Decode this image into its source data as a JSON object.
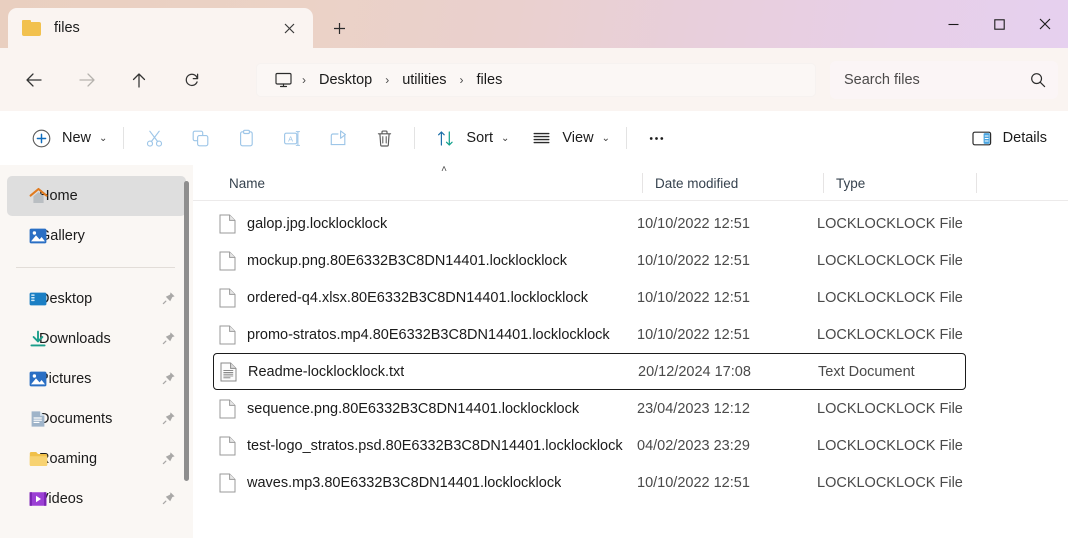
{
  "window": {
    "tab_title": "files",
    "tab_folder_icon": "folder-icon",
    "close_tab_icon": "close-icon",
    "new_tab_icon": "plus-icon",
    "minimize_icon": "minimize-icon",
    "maximize_icon": "maximize-icon",
    "close_icon": "close-icon",
    "titlebar_gradient_start": "#e9cfc0",
    "titlebar_gradient_end": "#e6d0ef"
  },
  "nav": {
    "back_icon": "arrow-left-icon",
    "forward_icon": "arrow-right-icon",
    "up_icon": "arrow-up-icon",
    "refresh_icon": "refresh-icon",
    "breadcrumb_root_icon": "desktop-monitor-icon",
    "breadcrumbs": [
      {
        "label": "Desktop"
      },
      {
        "label": "utilities"
      },
      {
        "label": "files"
      }
    ],
    "separator": "›"
  },
  "search": {
    "placeholder": "Search files",
    "icon": "search-icon"
  },
  "toolbar": {
    "new_label": "New",
    "new_icon": "plus-circle-icon",
    "cut_icon": "scissors-icon",
    "copy_icon": "copy-icon",
    "paste_icon": "paste-icon",
    "rename_icon": "rename-icon",
    "share_icon": "share-icon",
    "delete_icon": "trash-icon",
    "sort_label": "Sort",
    "sort_icon": "sort-arrows-icon",
    "view_label": "View",
    "view_icon": "view-lines-icon",
    "more_icon": "ellipsis-icon",
    "details_label": "Details",
    "details_icon": "details-pane-icon",
    "chevron": "⌄"
  },
  "sidebar": {
    "items": [
      {
        "label": "Home",
        "icon": "home-icon",
        "selected": true,
        "pinned": false
      },
      {
        "label": "Gallery",
        "icon": "gallery-icon",
        "selected": false,
        "pinned": false
      },
      {
        "label": "Desktop",
        "icon": "desktop-icon",
        "selected": false,
        "pinned": true
      },
      {
        "label": "Downloads",
        "icon": "download-icon",
        "selected": false,
        "pinned": true
      },
      {
        "label": "Pictures",
        "icon": "pictures-icon",
        "selected": false,
        "pinned": true
      },
      {
        "label": "Documents",
        "icon": "documents-icon",
        "selected": false,
        "pinned": true
      },
      {
        "label": "Roaming",
        "icon": "folder-icon",
        "selected": false,
        "pinned": true
      },
      {
        "label": "Videos",
        "icon": "videos-icon",
        "selected": false,
        "pinned": true
      }
    ],
    "scrollbar": "sidebar-scrollbar"
  },
  "file_list": {
    "columns": [
      {
        "label": "Name"
      },
      {
        "label": "Date modified"
      },
      {
        "label": "Type"
      }
    ],
    "sort_indicator": "˄",
    "rows": [
      {
        "name": "galop.jpg.locklocklock",
        "date": "10/10/2022 12:51",
        "type": "LOCKLOCKLOCK File",
        "icon": "generic-file-icon",
        "focused": false
      },
      {
        "name": "mockup.png.80E6332B3C8DN14401.locklocklock",
        "date": "10/10/2022 12:51",
        "type": "LOCKLOCKLOCK File",
        "icon": "generic-file-icon",
        "focused": false
      },
      {
        "name": "ordered-q4.xlsx.80E6332B3C8DN14401.locklocklock",
        "date": "10/10/2022 12:51",
        "type": "LOCKLOCKLOCK File",
        "icon": "generic-file-icon",
        "focused": false
      },
      {
        "name": "promo-stratos.mp4.80E6332B3C8DN14401.locklocklock",
        "date": "10/10/2022 12:51",
        "type": "LOCKLOCKLOCK File",
        "icon": "generic-file-icon",
        "focused": false
      },
      {
        "name": "Readme-locklocklock.txt",
        "date": "20/12/2024 17:08",
        "type": "Text Document",
        "icon": "text-document-icon",
        "focused": true
      },
      {
        "name": "sequence.png.80E6332B3C8DN14401.locklocklock",
        "date": "23/04/2023 12:12",
        "type": "LOCKLOCKLOCK File",
        "icon": "generic-file-icon",
        "focused": false
      },
      {
        "name": "test-logo_stratos.psd.80E6332B3C8DN14401.locklocklock",
        "date": "04/02/2023 23:29",
        "type": "LOCKLOCKLOCK File",
        "icon": "generic-file-icon",
        "focused": false
      },
      {
        "name": "waves.mp3.80E6332B3C8DN14401.locklocklock",
        "date": "10/10/2022 12:51",
        "type": "LOCKLOCKLOCK File",
        "icon": "generic-file-icon",
        "focused": false
      }
    ]
  }
}
